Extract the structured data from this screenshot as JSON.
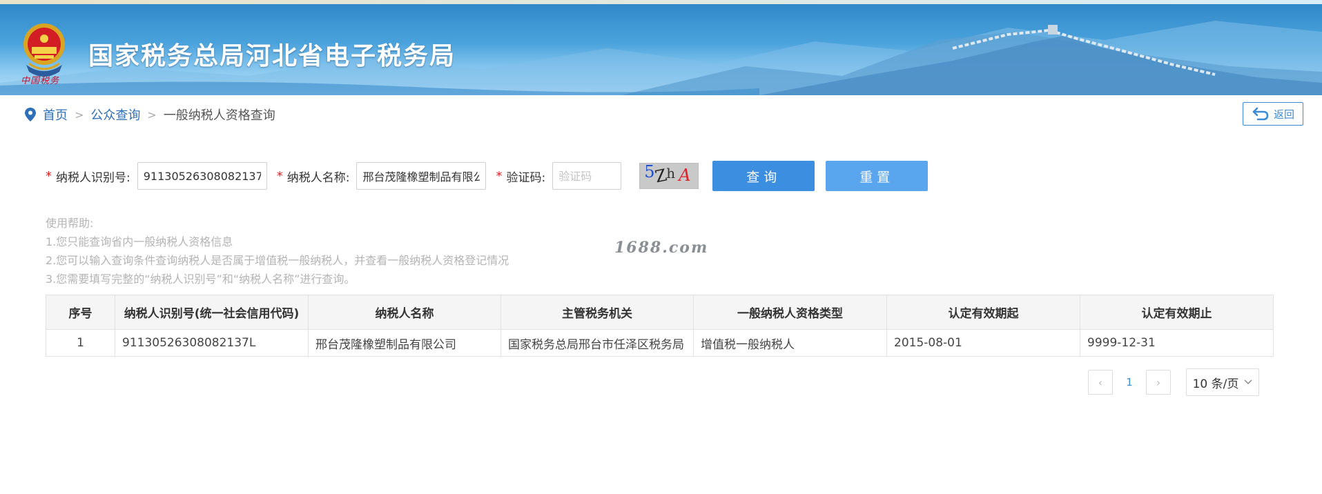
{
  "header": {
    "site_title": "国家税务总局河北省电子税务局",
    "emblem_caption": "中国税务"
  },
  "breadcrumb": {
    "home": "首页",
    "separator": ">",
    "public_query": "公众查询",
    "current": "一般纳税人资格查询"
  },
  "back_button": {
    "label": "返回"
  },
  "form": {
    "required_mark": "*",
    "taxpayer_id_label": "纳税人识别号:",
    "taxpayer_id_value": "91130526308082137L",
    "taxpayer_name_label": "纳税人名称:",
    "taxpayer_name_value": "邢台茂隆橡塑制品有限公司",
    "captcha_label": "验证码:",
    "captcha_placeholder": "验证码",
    "captcha_chars": [
      "5",
      "Z",
      "h",
      "A"
    ],
    "query_button": "查询",
    "reset_button": "重置"
  },
  "help": {
    "title": "使用帮助:",
    "lines": [
      "1.您只能查询省内一般纳税人资格信息",
      "2.您可以输入查询条件查询纳税人是否属于增值税一般纳税人，并查看一般纳税人资格登记情况",
      "3.您需要填写完整的“纳税人识别号”和“纳税人名称”进行查询。"
    ]
  },
  "watermark": "1688.com",
  "table": {
    "headers": [
      "序号",
      "纳税人识别号(统一社会信用代码)",
      "纳税人名称",
      "主管税务机关",
      "一般纳税人资格类型",
      "认定有效期起",
      "认定有效期止"
    ],
    "rows": [
      [
        "1",
        "91130526308082137L",
        "邢台茂隆橡塑制品有限公司",
        "国家税务总局邢台市任泽区税务局",
        "增值税一般纳税人",
        "2015-08-01",
        "9999-12-31"
      ]
    ]
  },
  "pagination": {
    "prev": "‹",
    "current_page": "1",
    "next": "›",
    "page_size": "10 条/页"
  },
  "colors": {
    "primary": "#3c8fe0",
    "reset": "#5aa6ee",
    "link": "#2d6fb8",
    "required": "#e02020"
  }
}
